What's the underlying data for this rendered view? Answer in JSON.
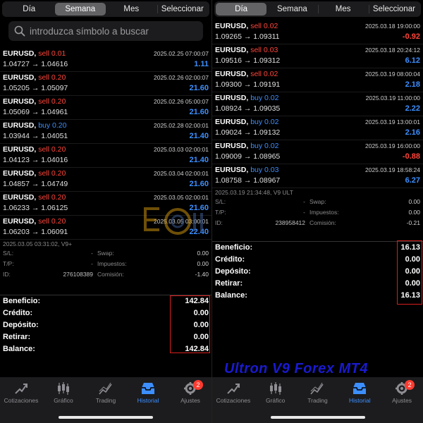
{
  "left": {
    "tabs": [
      {
        "label": "Día",
        "active": false
      },
      {
        "label": "Semana",
        "active": true
      },
      {
        "label": "Mes",
        "active": false
      },
      {
        "label": "Seleccionar",
        "active": false
      }
    ],
    "search_placeholder": "introduzca símbolo a buscar",
    "trades": [
      {
        "symbol": "EURUSD,",
        "side": "sell",
        "lot": "sell 0.01",
        "date": "2025.02.25 07:00:07",
        "prices": "1.04727 → 1.04616",
        "profit": "1.11"
      },
      {
        "symbol": "EURUSD,",
        "side": "sell",
        "lot": "sell 0.20",
        "date": "2025.02.26 02:00:07",
        "prices": "1.05205 → 1.05097",
        "profit": "21.60"
      },
      {
        "symbol": "EURUSD,",
        "side": "sell",
        "lot": "sell 0.20",
        "date": "2025.02.26 05:00:07",
        "prices": "1.05069 → 1.04961",
        "profit": "21.60"
      },
      {
        "symbol": "EURUSD,",
        "side": "buy",
        "lot": "buy 0.20",
        "date": "2025.02.28 02:00:01",
        "prices": "1.03944 → 1.04051",
        "profit": "21.40"
      },
      {
        "symbol": "EURUSD,",
        "side": "sell",
        "lot": "sell 0.20",
        "date": "2025.03.03 02:00:01",
        "prices": "1.04123 → 1.04016",
        "profit": "21.40"
      },
      {
        "symbol": "EURUSD,",
        "side": "sell",
        "lot": "sell 0.20",
        "date": "2025.03.04 02:00:01",
        "prices": "1.04857 → 1.04749",
        "profit": "21.60"
      },
      {
        "symbol": "EURUSD,",
        "side": "sell",
        "lot": "sell 0.20",
        "date": "2025.03.05 02:00:01",
        "prices": "1.06233 → 1.06125",
        "profit": "21.60"
      },
      {
        "symbol": "EURUSD,",
        "side": "sell",
        "lot": "sell 0.20",
        "date": "2025.03.05 03:00:01",
        "prices": "1.06203 → 1.06091",
        "profit": "22.40"
      }
    ],
    "info": {
      "timestamp": "2025.03.05 03:31:02, V9+",
      "sl_label": "S/L:",
      "sl_value": "-",
      "swap_label": "Swap:",
      "swap_value": "0.00",
      "tp_label": "T/P:",
      "tp_value": "-",
      "tax_label": "Impuestos:",
      "tax_value": "0.00",
      "id_label": "ID:",
      "id_value": "276108389",
      "commission_label": "Comisión:",
      "commission_value": "-1.40"
    },
    "summary": [
      {
        "label": "Beneficio:",
        "value": "142.84"
      },
      {
        "label": "Crédito:",
        "value": "0.00"
      },
      {
        "label": "Depósito:",
        "value": "0.00"
      },
      {
        "label": "Retirar:",
        "value": "0.00"
      },
      {
        "label": "Balance:",
        "value": "142.84"
      }
    ]
  },
  "right": {
    "tabs": [
      {
        "label": "Día",
        "active": true
      },
      {
        "label": "Semana",
        "active": false
      },
      {
        "label": "Mes",
        "active": false
      },
      {
        "label": "Seleccionar",
        "active": false
      }
    ],
    "trades": [
      {
        "symbol": "EURUSD,",
        "side": "sell",
        "lot": "sell 0.02",
        "date": "2025.03.18 19:00:00",
        "prices": "1.09265 → 1.09311",
        "profit": "-0.92"
      },
      {
        "symbol": "EURUSD,",
        "side": "sell",
        "lot": "sell 0.03",
        "date": "2025.03.18 20:24:12",
        "prices": "1.09516 → 1.09312",
        "profit": "6.12"
      },
      {
        "symbol": "EURUSD,",
        "side": "sell",
        "lot": "sell 0.02",
        "date": "2025.03.19 08:00:04",
        "prices": "1.09300 → 1.09191",
        "profit": "2.18"
      },
      {
        "symbol": "EURUSD,",
        "side": "buy",
        "lot": "buy 0.02",
        "date": "2025.03.19 11:00:00",
        "prices": "1.08924 → 1.09035",
        "profit": "2.22"
      },
      {
        "symbol": "EURUSD,",
        "side": "buy",
        "lot": "buy 0.02",
        "date": "2025.03.19 13:00:01",
        "prices": "1.09024 → 1.09132",
        "profit": "2.16"
      },
      {
        "symbol": "EURUSD,",
        "side": "buy",
        "lot": "buy 0.02",
        "date": "2025.03.19 16:00:00",
        "prices": "1.09009 → 1.08965",
        "profit": "-0.88"
      },
      {
        "symbol": "EURUSD,",
        "side": "buy",
        "lot": "buy 0.03",
        "date": "2025.03.19 18:58:24",
        "prices": "1.08758 → 1.08967",
        "profit": "6.27"
      }
    ],
    "info": {
      "timestamp": "2025.03.19 21:34:48, V9 ULT",
      "sl_label": "S/L:",
      "sl_value": "-",
      "swap_label": "Swap:",
      "swap_value": "0.00",
      "tp_label": "T/P:",
      "tp_value": "-",
      "tax_label": "Impuestos:",
      "tax_value": "0.00",
      "id_label": "ID:",
      "id_value": "238958412",
      "commission_label": "Comisión:",
      "commission_value": "-0.21"
    },
    "summary": [
      {
        "label": "Beneficio:",
        "value": "16.13"
      },
      {
        "label": "Crédito:",
        "value": "0.00"
      },
      {
        "label": "Depósito:",
        "value": "0.00"
      },
      {
        "label": "Retirar:",
        "value": "0.00"
      },
      {
        "label": "Balance:",
        "value": "16.13"
      }
    ]
  },
  "nav": [
    {
      "label": "Cotizaciones",
      "icon": "quotes-icon",
      "active": false
    },
    {
      "label": "Gráfico",
      "icon": "chart-icon",
      "active": false
    },
    {
      "label": "Trading",
      "icon": "trading-icon",
      "active": false
    },
    {
      "label": "Historial",
      "icon": "history-icon",
      "active": true
    },
    {
      "label": "Ajustes",
      "icon": "settings-icon",
      "active": false,
      "badge": "2"
    }
  ],
  "watermark_text": "Ultron V9 Forex MT4",
  "colors": {
    "sell": "#ff453a",
    "buy": "#3d8fff",
    "accent": "#3d8fff",
    "highlight_box": "#d81e1e"
  }
}
